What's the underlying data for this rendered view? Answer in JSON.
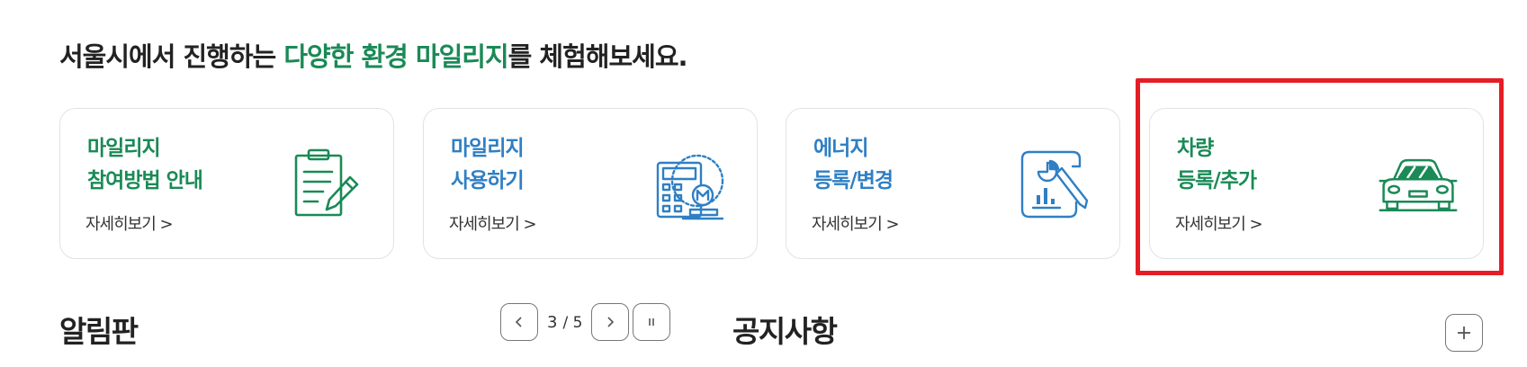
{
  "headline": {
    "prefix": "서울시에서 진행하는 ",
    "accent": "다양한 환경 마일리지",
    "suffix": "를 체험해보세요."
  },
  "cards": [
    {
      "line1": "마일리지",
      "line2": "참여방법 안내",
      "more": "자세히보기 >",
      "icon": "clipboard-pencil-icon",
      "color": "#1a8a56"
    },
    {
      "line1": "마일리지",
      "line2": "사용하기",
      "more": "자세히보기 >",
      "icon": "calculator-coin-icon",
      "color": "#2f7fc4"
    },
    {
      "line1": "에너지",
      "line2": "등록/변경",
      "more": "자세히보기 >",
      "icon": "report-chart-icon",
      "color": "#2f7fc4"
    },
    {
      "line1": "차량",
      "line2": "등록/추가",
      "more": "자세히보기 >",
      "icon": "car-icon",
      "color": "#1a8a56"
    }
  ],
  "notice_board": {
    "title": "알림판",
    "pager": {
      "current": "3",
      "total": "/ 5"
    }
  },
  "announcements": {
    "title": "공지사항"
  },
  "colors": {
    "accent_green": "#1a8a56",
    "accent_blue": "#2f7fc4",
    "highlight_red": "#e51e25"
  }
}
